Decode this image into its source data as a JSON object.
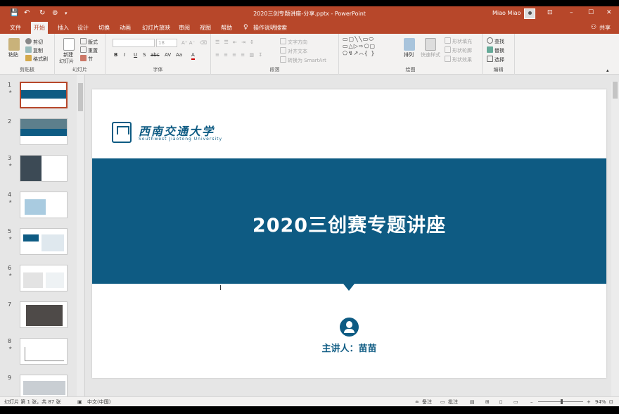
{
  "window": {
    "title": "2020三创专题讲座-分享.pptx - PowerPoint",
    "user_name": "Miao Miao",
    "controls": [
      "⊡",
      "–",
      "☐",
      "✕"
    ]
  },
  "quick_access": [
    "💾",
    "↶",
    "↻",
    "⊚"
  ],
  "tabs": [
    {
      "label": "文件"
    },
    {
      "label": "开始"
    },
    {
      "label": "插入"
    },
    {
      "label": "设计"
    },
    {
      "label": "切换"
    },
    {
      "label": "动画"
    },
    {
      "label": "幻灯片放映"
    },
    {
      "label": "审阅"
    },
    {
      "label": "视图"
    },
    {
      "label": "帮助"
    },
    {
      "label": "操作说明搜索"
    }
  ],
  "share_label": "共享",
  "ribbon": {
    "clipboard": {
      "label": "剪贴板",
      "paste": "粘贴",
      "cut": "剪切",
      "copy": "复制",
      "format_painter": "格式刷"
    },
    "slides": {
      "label": "幻灯片",
      "new_slide": "新建",
      "new_slide2": "幻灯片",
      "layout": "版式",
      "reset": "重置",
      "section": "节"
    },
    "font": {
      "label": "字体",
      "font_size": "18",
      "bold": "B",
      "italic": "I",
      "underline": "U",
      "shadow": "S",
      "strike": "abc",
      "spacing": "AV",
      "case": "Aa",
      "color": "A"
    },
    "paragraph": {
      "label": "段落",
      "text_dir": "文字方向",
      "align_text": "对齐文本",
      "smartart": "转换为 SmartArt"
    },
    "drawing": {
      "label": "绘图",
      "shapes_glyphs": "▭▢╲╲▭⬭ ▭△▷⇨⬠▢ ⬠↯↗⌒{ }",
      "arrange": "排列",
      "quick_styles": "快速样式",
      "fill": "形状填充",
      "outline": "形状轮廓",
      "effects": "形状效果"
    },
    "editing": {
      "label": "编辑",
      "find": "查找",
      "replace": "替换",
      "select": "选择"
    }
  },
  "slides": [
    {
      "number": "1"
    },
    {
      "number": "2"
    },
    {
      "number": "3"
    },
    {
      "number": "4"
    },
    {
      "number": "5"
    },
    {
      "number": "6"
    },
    {
      "number": "7"
    },
    {
      "number": "8"
    },
    {
      "number": "9"
    }
  ],
  "main_slide": {
    "university_name": "西南交通大学",
    "university_name_en": "Southwest Jiaotong University",
    "title": "2020三创赛专题讲座",
    "presenter": "主讲人：苗苗",
    "colors": {
      "band": "#0e5b83"
    }
  },
  "status": {
    "slide_info": "幻灯片 第 1 张，共 87 张",
    "language": "中文(中国)",
    "notes": "备注",
    "comments": "批注",
    "zoom": "94%"
  }
}
